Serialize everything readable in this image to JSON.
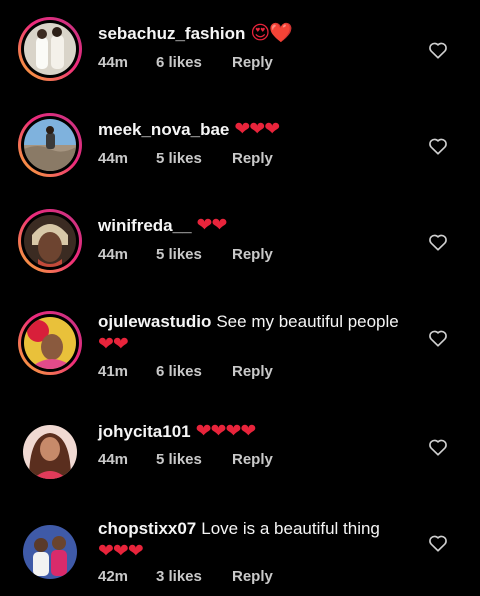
{
  "comments": [
    {
      "username": "sebachuz_fashion",
      "text": "",
      "emoji": "😍❤️",
      "time": "44m",
      "likes": "6 likes",
      "reply": "Reply"
    },
    {
      "username": "meek_nova_bae",
      "text": "",
      "emoji": "❤❤❤",
      "time": "44m",
      "likes": "5 likes",
      "reply": "Reply"
    },
    {
      "username": "winifreda__",
      "text": "",
      "emoji": "❤❤",
      "time": "44m",
      "likes": "5 likes",
      "reply": "Reply"
    },
    {
      "username": "ojulewastudio",
      "text": "See my beautiful people",
      "emoji": "❤❤",
      "time": "41m",
      "likes": "6 likes",
      "reply": "Reply"
    },
    {
      "username": "johycita101",
      "text": "",
      "emoji": "❤❤❤❤",
      "time": "44m",
      "likes": "5 likes",
      "reply": "Reply"
    },
    {
      "username": "chopstixx07",
      "text": "Love is a beautiful thing",
      "emoji": "❤❤❤",
      "time": "42m",
      "likes": "3 likes",
      "reply": "Reply"
    }
  ],
  "icons": {
    "like": "heart-outline-icon"
  },
  "colors": {
    "background": "#000000",
    "heart": "#e8243b",
    "ring_start": "#f9b233",
    "ring_end": "#c13584"
  }
}
